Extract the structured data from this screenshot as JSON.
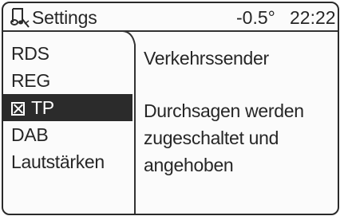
{
  "header": {
    "title": "Settings",
    "icon": "settings-music-icon",
    "temperature": "-0.5°",
    "time": "22:22"
  },
  "menu": {
    "items": [
      {
        "label": "RDS",
        "selected": false
      },
      {
        "label": "REG",
        "selected": false
      },
      {
        "label": "TP",
        "selected": true,
        "checked": true
      },
      {
        "label": "DAB",
        "selected": false
      },
      {
        "label": "Lautstärken",
        "selected": false
      }
    ]
  },
  "detail": {
    "heading": "Verkehrssender",
    "description_lines": [
      "Durchsagen werden",
      "zugeschaltet und",
      "angehoben"
    ]
  }
}
